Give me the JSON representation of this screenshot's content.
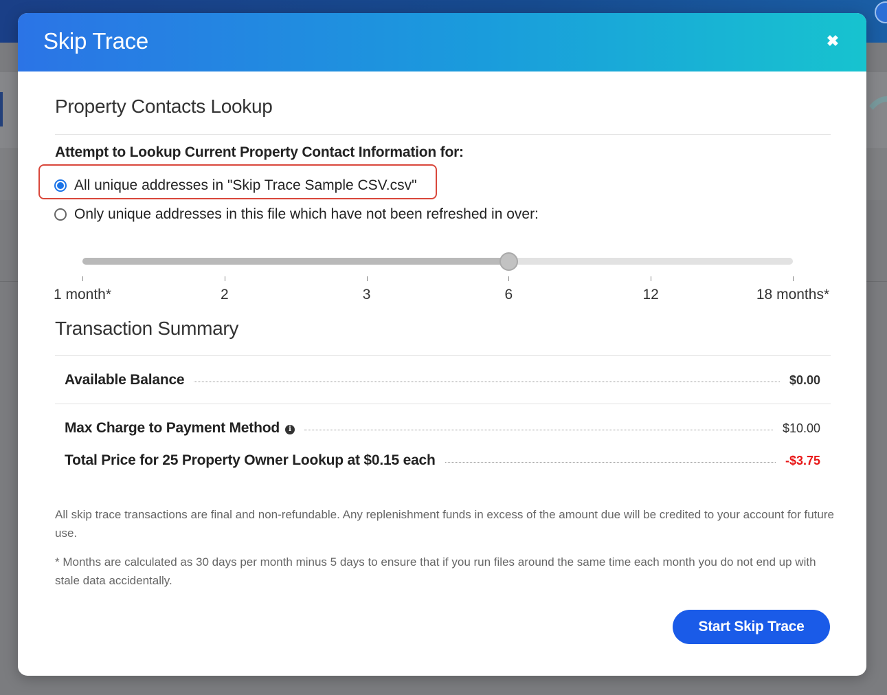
{
  "modal": {
    "title": "Skip Trace",
    "close_icon": "close-icon"
  },
  "lookup": {
    "heading": "Property Contacts Lookup",
    "prompt": "Attempt to Lookup Current Property Contact Information for:",
    "options": [
      {
        "label": "All unique addresses in \"Skip Trace Sample CSV.csv\"",
        "checked": true
      },
      {
        "label": "Only unique addresses in this file which have not been refreshed in over:",
        "checked": false
      }
    ]
  },
  "slider": {
    "ticks": [
      "1 month*",
      "2",
      "3",
      "6",
      "12",
      "18 months*"
    ],
    "selected_index": 3,
    "selected_value": "6"
  },
  "summary": {
    "heading": "Transaction Summary",
    "available_balance_label": "Available Balance",
    "available_balance_value": "$0.00",
    "max_charge_label": "Max Charge to Payment Method",
    "max_charge_value": "$10.00",
    "total_price_label": "Total Price for 25 Property Owner Lookup at $0.15 each",
    "total_price_value": "-$3.75"
  },
  "notes": {
    "refund": "All skip trace transactions are final and non-refundable. Any replenishment funds in excess of the amount due will be credited to your account for future use.",
    "months": "* Months are calculated as 30 days per month minus 5 days to ensure that if you run files around the same time each month you do not end up with stale data accidentally."
  },
  "actions": {
    "start_label": "Start Skip Trace"
  },
  "colors": {
    "accent": "#1a5be8",
    "header_start": "#2b74e6",
    "header_end": "#17c3cf",
    "negative": "#e81818",
    "highlight": "#d9473b"
  }
}
